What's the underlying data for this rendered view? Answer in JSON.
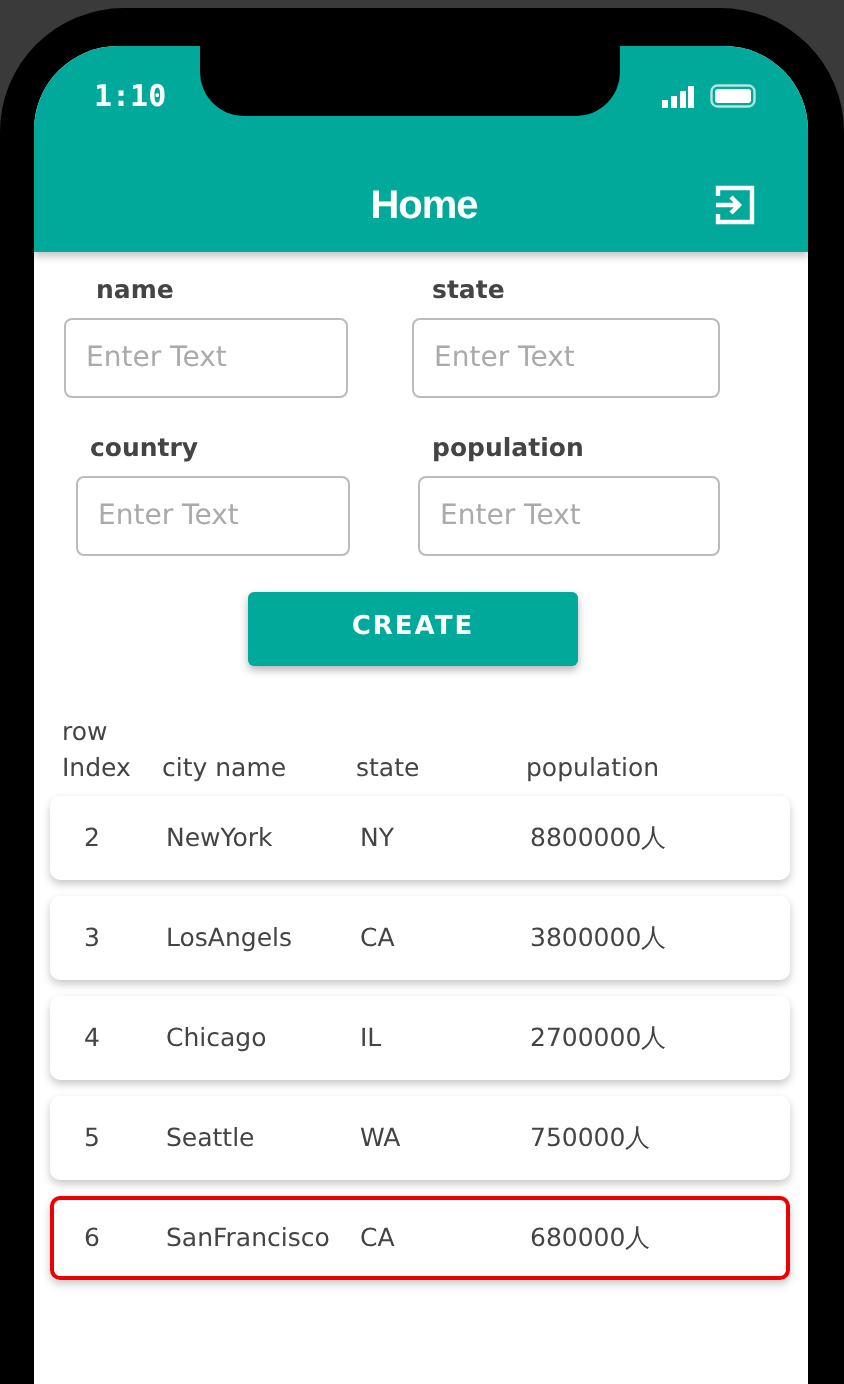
{
  "status_bar": {
    "time": "1:10"
  },
  "header": {
    "title": "Home"
  },
  "form": {
    "fields": [
      {
        "label": "name",
        "placeholder": "Enter Text"
      },
      {
        "label": "state",
        "placeholder": "Enter Text"
      },
      {
        "label": "country",
        "placeholder": "Enter Text"
      },
      {
        "label": "population",
        "placeholder": "Enter Text"
      }
    ],
    "button": "CREATE"
  },
  "table": {
    "columns": [
      "row Index",
      "city name",
      "state",
      "population"
    ],
    "rows": [
      {
        "cells": [
          "2",
          "NewYork",
          "NY",
          "8800000人"
        ],
        "highlighted": false
      },
      {
        "cells": [
          "3",
          "LosAngels",
          "CA",
          "3800000人"
        ],
        "highlighted": false
      },
      {
        "cells": [
          "4",
          "Chicago",
          "IL",
          "2700000人"
        ],
        "highlighted": false
      },
      {
        "cells": [
          "5",
          "Seattle",
          "WA",
          "750000人"
        ],
        "highlighted": false
      },
      {
        "cells": [
          "6",
          "SanFrancisco",
          "CA",
          "680000人"
        ],
        "highlighted": true
      }
    ]
  }
}
